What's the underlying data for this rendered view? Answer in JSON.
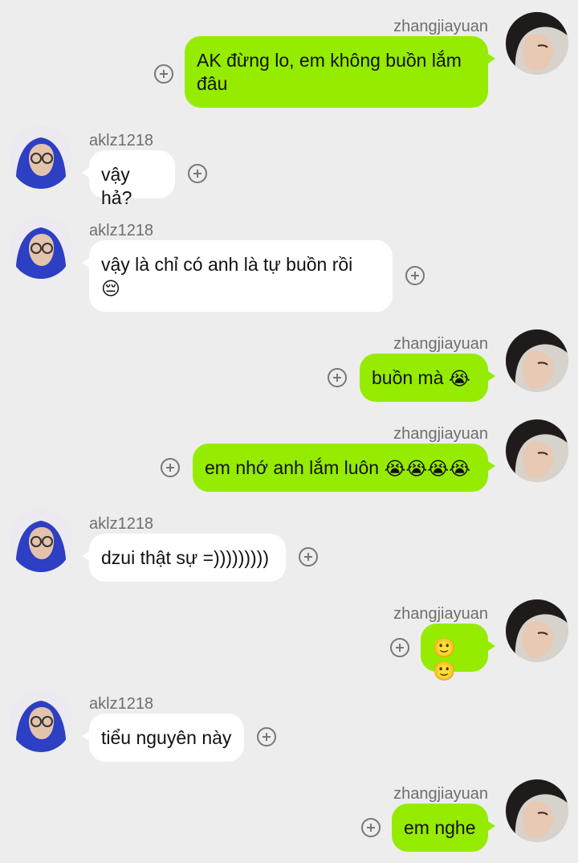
{
  "messages": [
    {
      "side": "right",
      "sender": "zhangjiayuan",
      "text": "AK đừng lo, em không buồn lắm đâu"
    },
    {
      "side": "left",
      "sender": "aklz1218",
      "text": "vậy hả?"
    },
    {
      "side": "left",
      "sender": "aklz1218",
      "text": "vậy là chỉ có anh là tự buồn rồi",
      "emoji": "😔"
    },
    {
      "side": "right",
      "sender": "zhangjiayuan",
      "text": "buồn mà",
      "emoji": "😭"
    },
    {
      "side": "right",
      "sender": "zhangjiayuan",
      "text": "em nhớ anh lắm luôn",
      "emoji": "😭😭😭😭"
    },
    {
      "side": "left",
      "sender": "aklz1218",
      "text": "dzui thật sự =)))))))))"
    },
    {
      "side": "right",
      "sender": "zhangjiayuan",
      "text": "",
      "emoji": "🙂🙂"
    },
    {
      "side": "left",
      "sender": "aklz1218",
      "text": "tiểu nguyên này"
    },
    {
      "side": "right",
      "sender": "zhangjiayuan",
      "text": "em nghe"
    }
  ],
  "icons": {
    "add": "add-circle-icon",
    "avatar_right": "user-avatar-zhangjiayuan",
    "avatar_left": "user-avatar-aklz1218"
  },
  "colors": {
    "background": "#ededed",
    "sent_bubble": "#95ec00",
    "received_bubble": "#ffffff"
  }
}
